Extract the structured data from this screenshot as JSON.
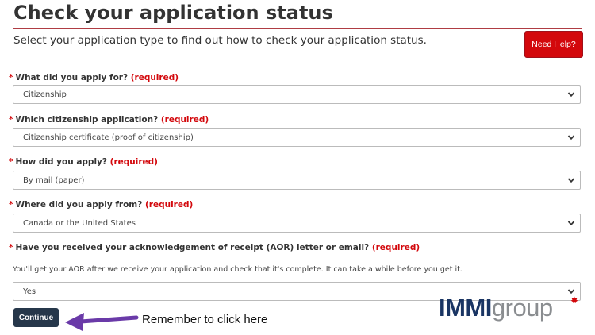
{
  "page": {
    "title": "Check your application status",
    "intro": "Select your application type to find out how to check your application status.",
    "help_button": "Need Help?"
  },
  "questions": [
    {
      "label": "What did you apply for?",
      "required": "(required)",
      "value": "Citizenship"
    },
    {
      "label": "Which citizenship application?",
      "required": "(required)",
      "value": "Citizenship certificate (proof of citizenship)"
    },
    {
      "label": "How did you apply?",
      "required": "(required)",
      "value": "By mail (paper)"
    },
    {
      "label": "Where did you apply from?",
      "required": "(required)",
      "value": "Canada or the United States"
    },
    {
      "label": "Have you received your acknowledgement of receipt (AOR) letter or email?",
      "required": "(required)",
      "value": "Yes",
      "note": "You'll get your AOR after we receive your application and check that it's complete. It can take a while before you get it."
    }
  ],
  "asterisk": "*",
  "continue_button": "Continue",
  "annotation": {
    "text": "Remember to click here",
    "arrow_color": "#6a3aa8"
  },
  "logo": {
    "part1": "IMMI",
    "part2": "group"
  },
  "colors": {
    "required": "#d3080c",
    "rule": "#af3c43",
    "continue_bg": "#26374a",
    "help_bg": "#d3080c"
  }
}
